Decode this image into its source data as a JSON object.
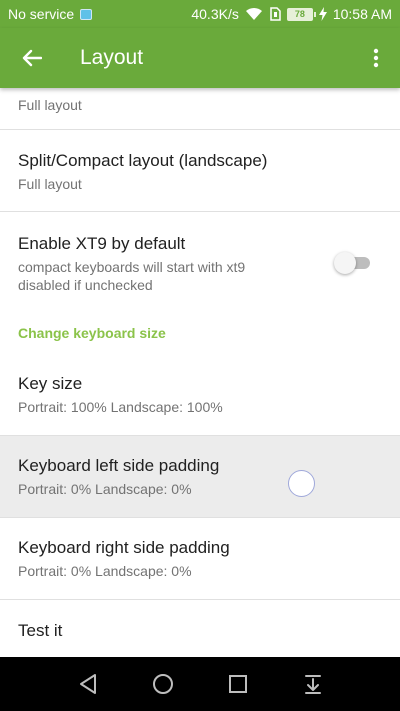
{
  "status_bar": {
    "carrier": "No service",
    "speed": "40.3K/s",
    "battery": "78",
    "time": "10:58 AM"
  },
  "app_bar": {
    "title": "Layout",
    "back_icon": "arrow-back-icon",
    "menu_icon": "more-vert-icon"
  },
  "prefs": {
    "partial": {
      "summary": "Full layout"
    },
    "split": {
      "title": "Split/Compact layout (landscape)",
      "summary": "Full layout"
    },
    "xt9": {
      "title": "Enable XT9 by default",
      "summary": "compact keyboards will start with xt9 disabled if unchecked",
      "checked": false
    },
    "category": {
      "title": "Change keyboard size"
    },
    "key_size": {
      "title": "Key size",
      "summary": "Portrait: 100% Landscape: 100%"
    },
    "left_padding": {
      "title": "Keyboard left side padding",
      "summary": "Portrait: 0% Landscape: 0%"
    },
    "right_padding": {
      "title": "Keyboard right side padding",
      "summary": "Portrait: 0% Landscape: 0%"
    },
    "test": {
      "title": "Test it"
    }
  },
  "colors": {
    "primary": "#6aaa3b",
    "accent": "#8bc34a",
    "pressed_row": "#ececec"
  },
  "nav_bar": {
    "icons": [
      "back-triangle-icon",
      "home-circle-icon",
      "recents-square-icon",
      "notification-pull-icon"
    ]
  }
}
